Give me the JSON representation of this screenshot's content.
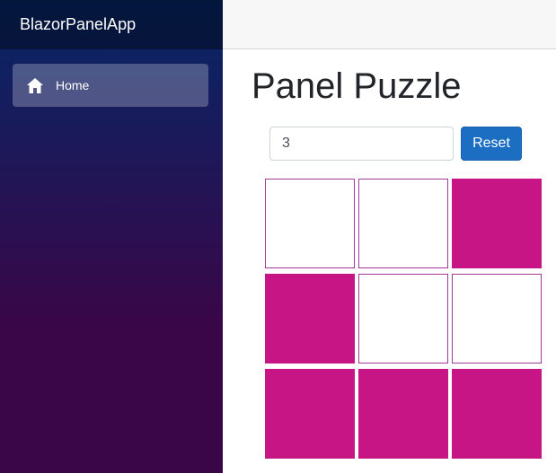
{
  "app": {
    "brand": "BlazorPanelApp"
  },
  "sidebar": {
    "items": [
      {
        "label": "Home",
        "icon": "home-icon"
      }
    ]
  },
  "page": {
    "title": "Panel Puzzle"
  },
  "controls": {
    "size_value": "3",
    "reset_label": "Reset"
  },
  "puzzle": {
    "size": 3,
    "on_color": "#c71585",
    "off_color": "#ffffff",
    "border_color": "#a13a9c",
    "cells": [
      [
        false,
        false,
        true
      ],
      [
        true,
        false,
        false
      ],
      [
        true,
        true,
        true
      ]
    ]
  },
  "colors": {
    "sidebar_top": "#052767",
    "sidebar_bottom": "#3a0647",
    "accent": "#1b6ec2"
  }
}
